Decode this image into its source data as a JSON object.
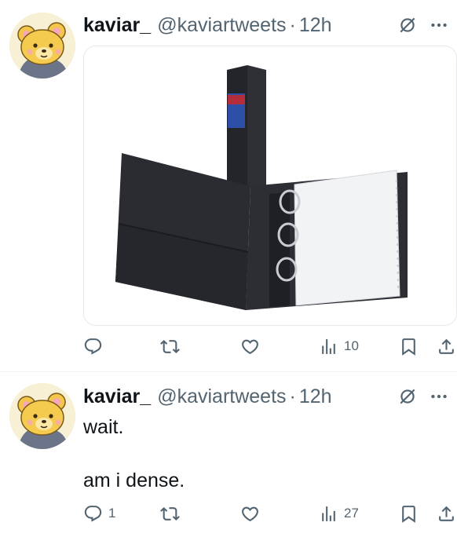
{
  "tweets": [
    {
      "author": {
        "display_name": "kaviar_",
        "handle": "@kaviartweets"
      },
      "separator": "·",
      "time": "12h",
      "text": [],
      "media": {
        "type": "photo",
        "description_icon": "binder-photo"
      },
      "actions": {
        "reply": {
          "icon": "reply-icon",
          "count": ""
        },
        "repost": {
          "icon": "repost-icon",
          "count": ""
        },
        "like": {
          "icon": "heart-icon",
          "count": ""
        },
        "views": {
          "icon": "views-icon",
          "count": "10"
        },
        "bookmark": {
          "icon": "bookmark-icon"
        },
        "share": {
          "icon": "share-icon"
        }
      }
    },
    {
      "author": {
        "display_name": "kaviar_",
        "handle": "@kaviartweets"
      },
      "separator": "·",
      "time": "12h",
      "text": [
        "wait.",
        "am i dense."
      ],
      "actions": {
        "reply": {
          "icon": "reply-icon",
          "count": "1"
        },
        "repost": {
          "icon": "repost-icon",
          "count": ""
        },
        "like": {
          "icon": "heart-icon",
          "count": ""
        },
        "views": {
          "icon": "views-icon",
          "count": "27"
        },
        "bookmark": {
          "icon": "bookmark-icon"
        },
        "share": {
          "icon": "share-icon"
        }
      }
    }
  ],
  "colors": {
    "text_primary": "#0f1419",
    "text_secondary": "#536471",
    "divider": "#eff3f4"
  }
}
